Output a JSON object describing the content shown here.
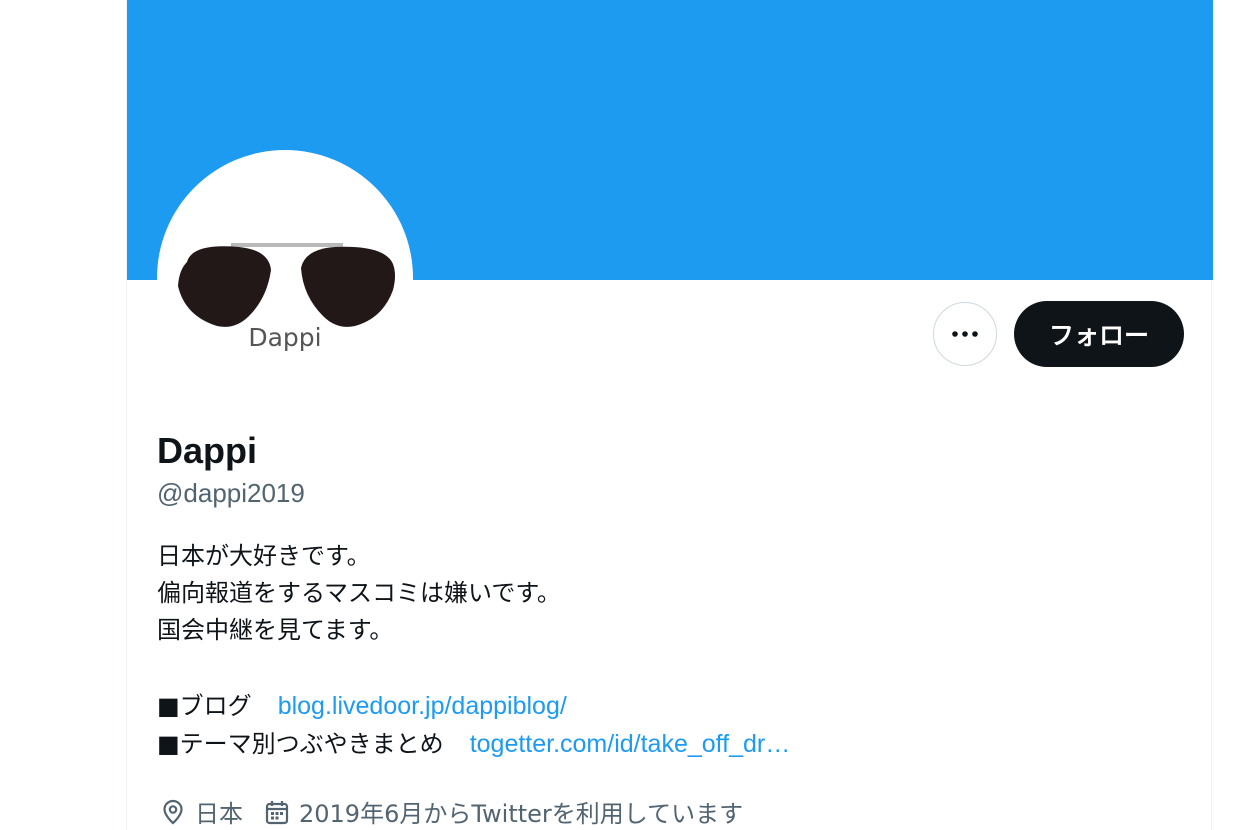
{
  "colors": {
    "banner": "#1d9bf0",
    "follow_button_bg": "#0f1419",
    "link": "#1d9bf0",
    "secondary_text": "#536471"
  },
  "avatar": {
    "logo_text": "Dappi"
  },
  "actions": {
    "more_icon": "more-horizontal-icon",
    "follow_label": "フォロー"
  },
  "profile": {
    "display_name": "Dappi",
    "handle": "@dappi2019"
  },
  "bio": {
    "lines": [
      "日本が大好きです。",
      "偏向報道をするマスコミは嫌いです。",
      "国会中継を見てます。"
    ],
    "links": [
      {
        "label": "■ブログ",
        "url_text": "blog.livedoor.jp/dappiblog/"
      },
      {
        "label": "■テーマ別つぶやきまとめ",
        "url_text": "togetter.com/id/take_off_dr…"
      }
    ]
  },
  "meta": {
    "location": "日本",
    "location_icon": "location-pin-icon",
    "joined": "2019年6月からTwitterを利用しています",
    "joined_icon": "calendar-icon"
  }
}
